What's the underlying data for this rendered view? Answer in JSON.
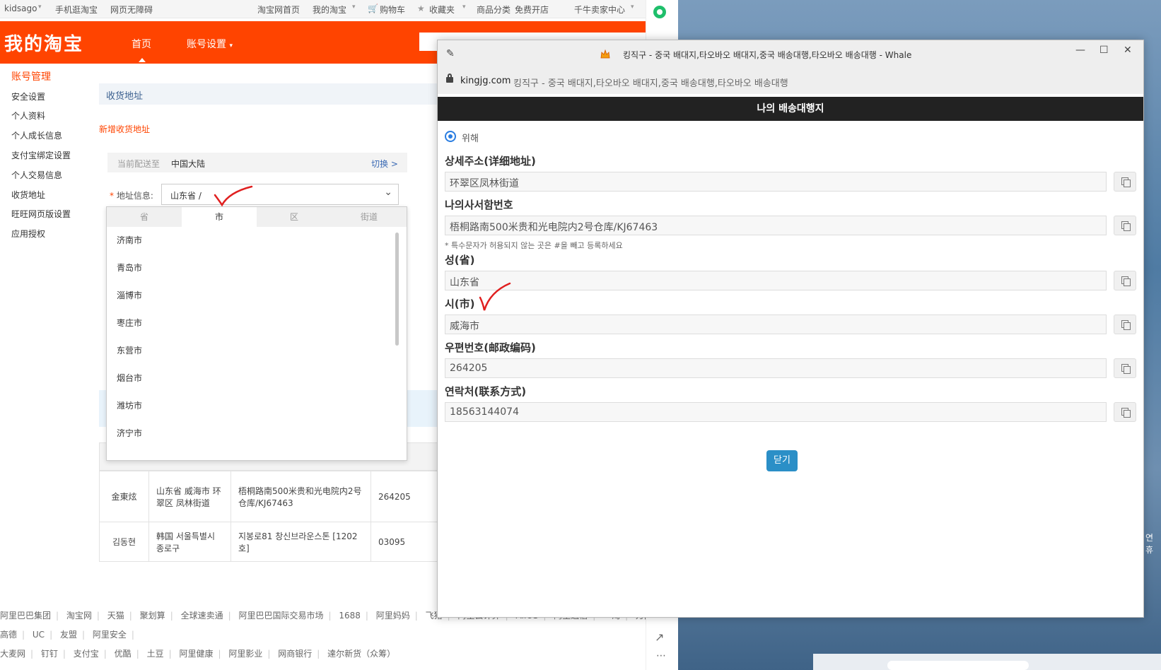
{
  "browser_bar": {
    "user": "kidsago",
    "mobile": "手机逛淘宝",
    "accessible": "网页无障碍",
    "home": "淘宝网首页",
    "my_taobao": "我的淘宝",
    "cart": "购物车",
    "favorites": "收藏夹",
    "categories": "商品分类",
    "open_shop": "免费开店",
    "seller_center": "千牛卖家中心"
  },
  "taobao": {
    "logo": "我的淘宝",
    "nav_home": "首页",
    "nav_account": "账号设置",
    "menu_title": "账号管理",
    "menu": [
      "安全设置",
      "个人资料",
      "个人成长信息",
      "支付宝绑定设置",
      "个人交易信息",
      "收货地址",
      "旺旺网页版设置",
      "应用授权"
    ],
    "section_title": "收货地址",
    "new_address": "新增收货地址",
    "deliver_label": "当前配送至",
    "deliver_value": "中国大陆",
    "switch_label": "切换 >",
    "address_label": "地址信息:",
    "address_value": "山东省 /",
    "tabs": [
      "省",
      "市",
      "区",
      "街道"
    ],
    "active_tab": "市",
    "cities": [
      "济南市",
      "青岛市",
      "淄博市",
      "枣庄市",
      "东营市",
      "烟台市",
      "潍坊市",
      "济宁市"
    ],
    "table_rows": [
      {
        "name": "金東炫",
        "region": "山东省 威海市 环翠区 凤林街道",
        "detail": "梧桐路南500米贵和光电院内2号仓库/KJ67463",
        "zip": "264205"
      },
      {
        "name": "김동현",
        "region": "韩国 서울특별시 종로구",
        "detail": "지봉로81 창신브라운스톤 [1202호]",
        "zip": "03095"
      }
    ],
    "footer_row1": [
      "阿里巴巴集团",
      "淘宝网",
      "天猫",
      "聚划算",
      "全球速卖通",
      "阿里巴巴国际交易市场",
      "1688",
      "阿里妈妈",
      "飞猪",
      "阿里云计算",
      "AliOS",
      "阿里通信",
      "一淘",
      "万网"
    ],
    "footer_row2": [
      "高德",
      "UC",
      "友盟",
      "阿里安全"
    ],
    "footer_row3": [
      "大麦网",
      "钉钉",
      "支付宝",
      "优酷",
      "土豆",
      "阿里健康",
      "阿里影业",
      "网商银行",
      "達尔新货（众筹）"
    ]
  },
  "popup": {
    "window_title": "킹직구 - 중국 배대지,타오바오 배대지,중국 배송대행,타오바오 배송대행 - Whale",
    "url_domain": "kingjg.com",
    "url_title": "킹직구 - 중국 배대지,타오바오 배대지,중국 배송대행,타오바오 배송대행",
    "header": "나의 배송대행지",
    "radio_label": "위해",
    "fields": [
      {
        "label": "상세주소(详细地址)",
        "value": "环翠区凤林街道"
      },
      {
        "label": "나의사서함번호",
        "value": "梧桐路南500米贵和光电院内2号仓库/KJ67463"
      },
      {
        "label": "성(省)",
        "value": "山东省"
      },
      {
        "label": "시(市)",
        "value": "威海市"
      },
      {
        "label": "우편번호(邮政编码)",
        "value": "264205"
      },
      {
        "label": "연락처(联系方式)",
        "value": "18563144074"
      }
    ],
    "hint": "* 특수문자가 허용되지 않는 곳은 #을 빼고 등록하세요",
    "close_label": "닫기"
  },
  "desktop": {
    "side_text": "연휴"
  },
  "colors": {
    "taobao_orange": "#ff4400",
    "popup_header": "#222222",
    "close_button": "#2b8fc7",
    "check_mark": "#e02020"
  },
  "icons": [
    "pin-icon",
    "lock-icon",
    "copy-icon",
    "minimize-icon",
    "maximize-icon",
    "close-icon",
    "chevron-down-icon",
    "cart-icon",
    "star-icon",
    "check-mark-icon",
    "external-link-icon",
    "more-icon"
  ]
}
